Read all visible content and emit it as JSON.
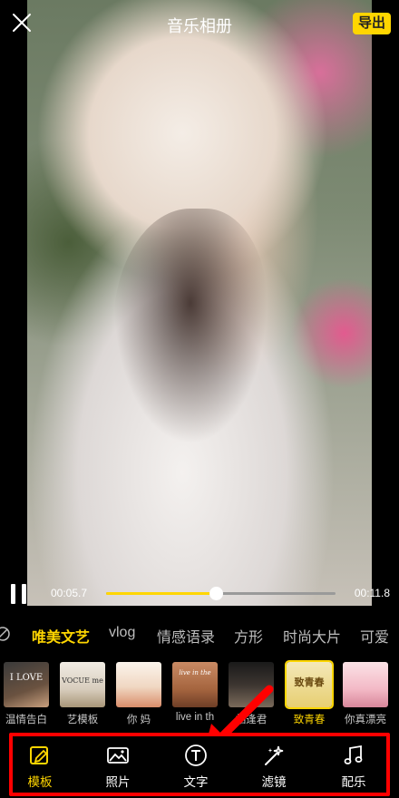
{
  "header": {
    "title": "音乐相册",
    "export_label": "导出"
  },
  "player": {
    "current_time": "00:05.7",
    "total_time": "00:11.8",
    "progress": 0.48
  },
  "categories": {
    "items": [
      "唯美文艺",
      "vlog",
      "情感语录",
      "方形",
      "时尚大片",
      "可爱"
    ],
    "active_index": 0
  },
  "templates": {
    "items": [
      {
        "label": "温情告白",
        "thumb_text": "I LOVE"
      },
      {
        "label": "艺模板",
        "thumb_text": "VOCUE me"
      },
      {
        "label": "你   妈",
        "thumb_text": ""
      },
      {
        "label": "live in th",
        "thumb_text": "live in the"
      },
      {
        "label": "相逢君",
        "thumb_text": ""
      },
      {
        "label": "致青春",
        "thumb_text": "致青春"
      },
      {
        "label": "你真漂亮",
        "thumb_text": ""
      }
    ],
    "selected_index": 5
  },
  "nav": {
    "items": [
      {
        "label": "模板",
        "icon": "template-icon"
      },
      {
        "label": "照片",
        "icon": "photo-icon"
      },
      {
        "label": "文字",
        "icon": "text-icon"
      },
      {
        "label": "滤镜",
        "icon": "filter-icon"
      },
      {
        "label": "配乐",
        "icon": "music-icon"
      }
    ],
    "active_index": 0
  },
  "colors": {
    "accent": "#ffd600",
    "annotation": "#ff0000",
    "background": "#000000"
  }
}
